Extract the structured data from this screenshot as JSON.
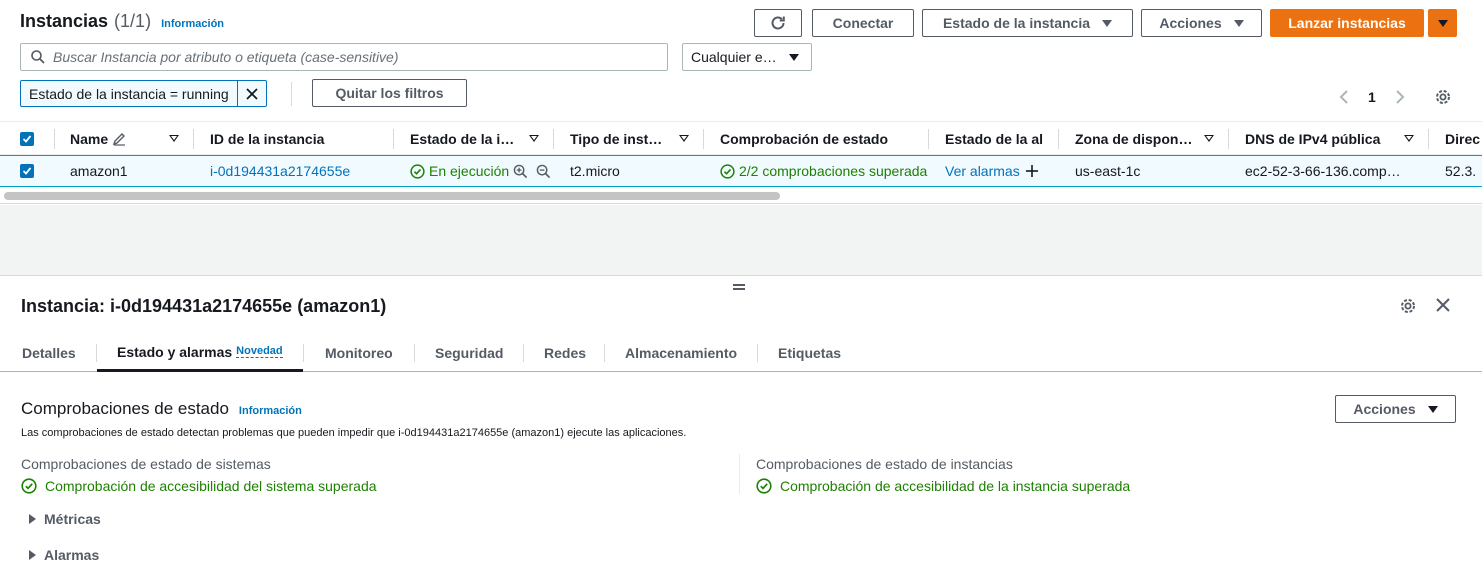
{
  "list": {
    "title": "Instancias",
    "count": "(1/1)",
    "info_link": "Información",
    "buttons": {
      "refresh_icon": "refresh-icon",
      "connect": "Conectar",
      "instance_state": "Estado de la instancia",
      "actions": "Acciones",
      "launch": "Lanzar instancias"
    },
    "search": {
      "placeholder": "Buscar Instancia por atributo o etiqueta (case-sensitive)",
      "value": ""
    },
    "state_select": {
      "value": "Cualquier e…"
    },
    "filter_token": "Estado de la instancia = running",
    "clear_filters": "Quitar los filtros",
    "pagination": {
      "page": "1"
    }
  },
  "table": {
    "columns": [
      "Name",
      "ID de la instancia",
      "Estado de la i…",
      "Tipo de inst…",
      "Comprobación de estado",
      "Estado de la ala",
      "Zona de dispon…",
      "DNS de IPv4 pública",
      "Direc"
    ],
    "rows": [
      {
        "name": "amazon1",
        "instance_id": "i-0d194431a2174655e",
        "state": "En ejecución",
        "type": "t2.micro",
        "status_check": "2/2 comprobaciones superada",
        "alarms": "Ver alarmas",
        "zone": "us-east-1c",
        "dns": "ec2-52-3-66-136.comp…",
        "ip": "52.3."
      }
    ]
  },
  "detail": {
    "title": "Instancia: i-0d194431a2174655e (amazon1)",
    "tabs": [
      {
        "label": "Detalles"
      },
      {
        "label": "Estado y alarmas",
        "badge": "Novedad"
      },
      {
        "label": "Monitoreo"
      },
      {
        "label": "Seguridad"
      },
      {
        "label": "Redes"
      },
      {
        "label": "Almacenamiento"
      },
      {
        "label": "Etiquetas"
      }
    ],
    "section": {
      "title": "Comprobaciones de estado",
      "info_link": "Información",
      "actions": "Acciones",
      "description": "Las comprobaciones de estado detectan problemas que pueden impedir que i-0d194431a2174655e (amazon1) ejecute las aplicaciones.",
      "system": {
        "heading": "Comprobaciones de estado de sistemas",
        "status": "Comprobación de accesibilidad del sistema superada"
      },
      "instance": {
        "heading": "Comprobaciones de estado de instancias",
        "status": "Comprobación de accesibilidad de la instancia superada"
      },
      "expanders": [
        "Métricas",
        "Alarmas"
      ]
    }
  },
  "colors": {
    "primary": "#ec7211",
    "link": "#0073bb",
    "success": "#1d8102",
    "selected_row": "#f1faff"
  }
}
